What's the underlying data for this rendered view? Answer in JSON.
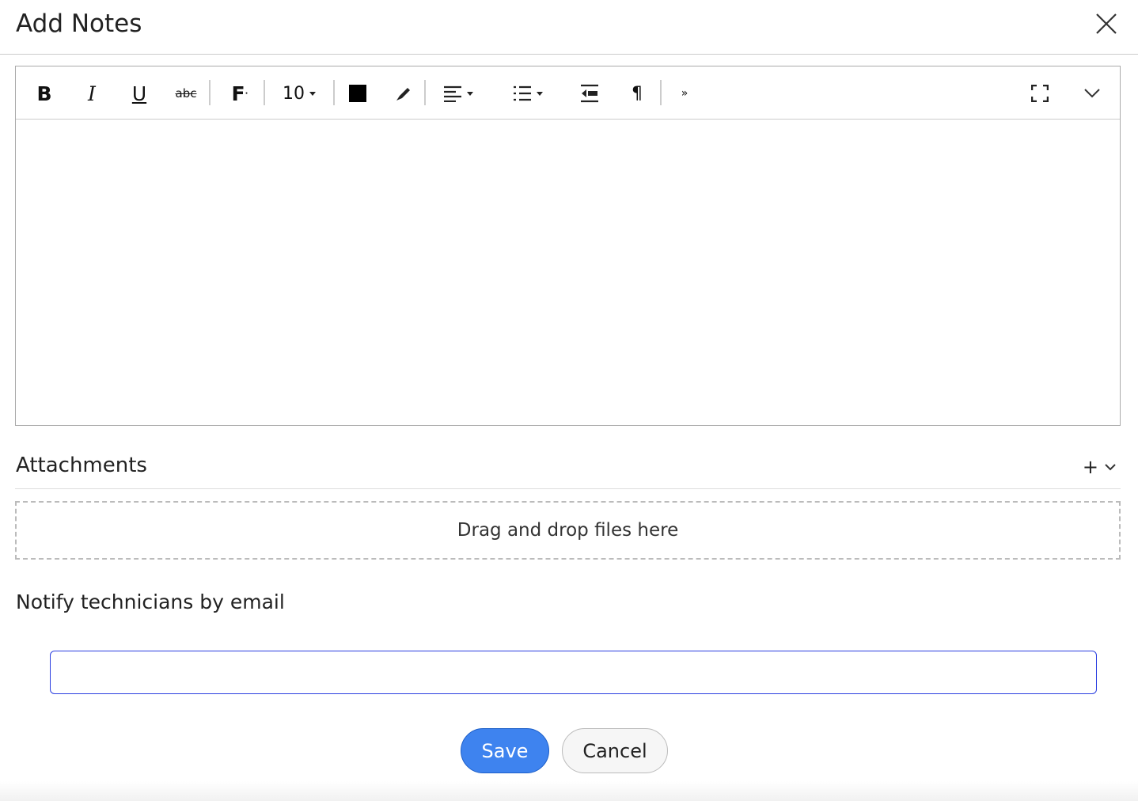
{
  "dialog": {
    "title": "Add Notes"
  },
  "toolbar": {
    "font_size": "10",
    "font_label": "F"
  },
  "attachments": {
    "title": "Attachments",
    "add": "+",
    "drop_text": "Drag and drop files here"
  },
  "notify": {
    "label": "Notify technicians by email",
    "value": ""
  },
  "buttons": {
    "save": "Save",
    "cancel": "Cancel"
  }
}
